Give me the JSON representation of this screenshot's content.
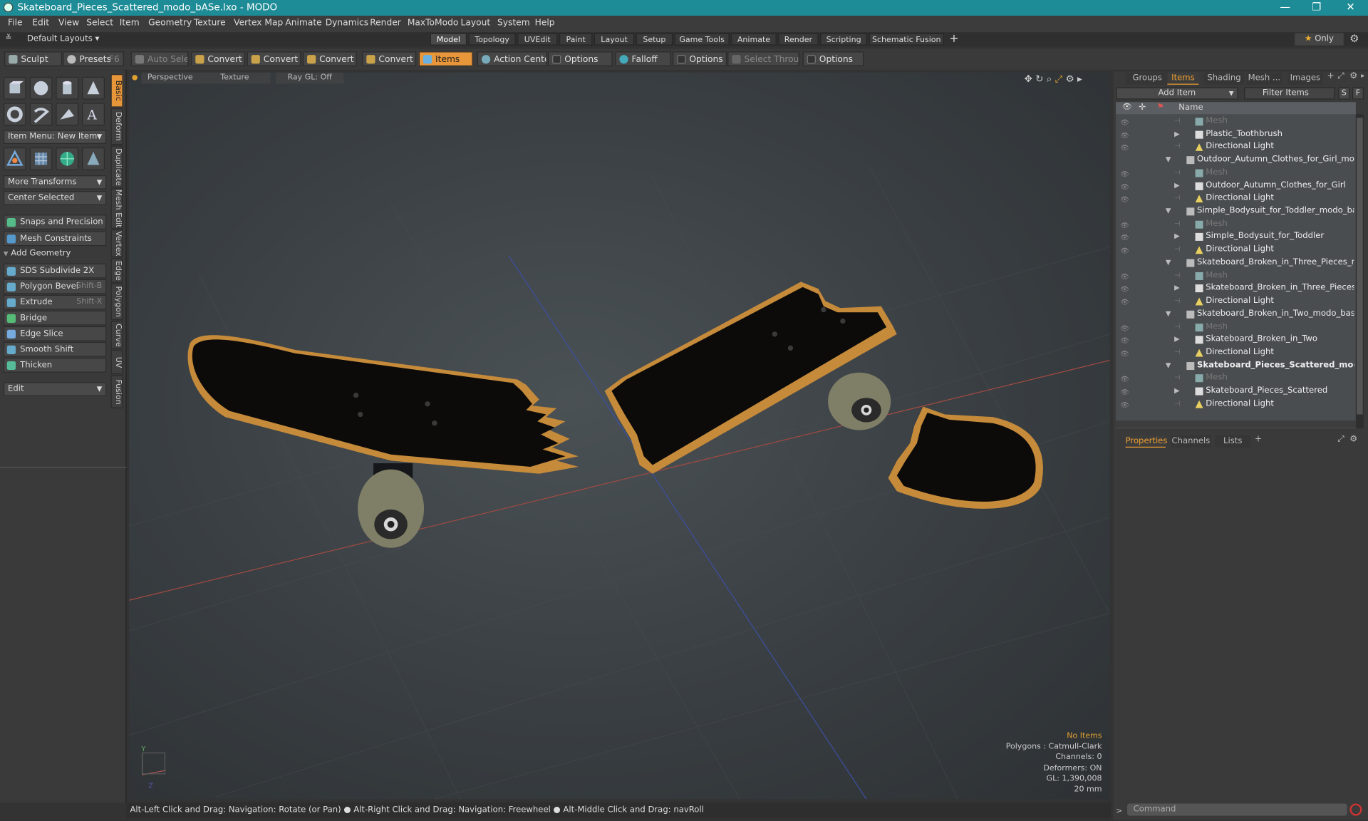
{
  "title": "Skateboard_Pieces_Scattered_modo_bASe.lxo - MODO",
  "window_controls": [
    "—",
    "❐",
    "✕"
  ],
  "menu": [
    "File",
    "Edit",
    "View",
    "Select",
    "Item",
    "Geometry",
    "Texture",
    "Vertex Map",
    "Animate",
    "Dynamics",
    "Render",
    "MaxToModo",
    "Layout",
    "System",
    "Help"
  ],
  "layout_selector": "Default Layouts",
  "layout_tabs": [
    "Model",
    "Topology",
    "UVEdit",
    "Paint",
    "Layout",
    "Setup",
    "Game Tools",
    "Animate",
    "Render",
    "Scripting",
    "Schematic Fusion"
  ],
  "active_layout_tab": "Model",
  "only_label": "Only",
  "toolbar": {
    "sculpt": "Sculpt",
    "presets": "Presets",
    "presets_key": "F6",
    "auto_select": "Auto Select",
    "convert1": "Convert",
    "convert2": "Convert",
    "convert3": "Convert",
    "convert4": "Convert",
    "items": "Items",
    "action_center": "Action Center",
    "options1": "Options",
    "falloff": "Falloff",
    "options2": "Options",
    "select_through": "Select Through",
    "options3": "Options"
  },
  "left_panel": {
    "item_menu": "Item Menu: New Item",
    "more_transforms": "More Transforms",
    "center_selected": "Center Selected",
    "snaps": "Snaps and Precision",
    "mesh_constraints": "Mesh Constraints",
    "add_geometry": "Add Geometry",
    "tools": [
      {
        "label": "SDS Subdivide 2X",
        "shortcut": ""
      },
      {
        "label": "Polygon Bevel",
        "shortcut": "Shift-B"
      },
      {
        "label": "Extrude",
        "shortcut": "Shift-X"
      },
      {
        "label": "Bridge",
        "shortcut": ""
      },
      {
        "label": "Edge Slice",
        "shortcut": ""
      },
      {
        "label": "Smooth Shift",
        "shortcut": ""
      },
      {
        "label": "Thicken",
        "shortcut": ""
      }
    ],
    "edit": "Edit",
    "vertical_tabs": [
      "Basic",
      "Deform",
      "Duplicate",
      "Mesh Edit",
      "Vertex",
      "Edge",
      "Polygon",
      "Curve",
      "UV",
      "Fusion"
    ]
  },
  "viewport": {
    "header": [
      "Perspective",
      "Texture",
      "Ray GL: Off"
    ],
    "info": {
      "no_items": "No Items",
      "polygons": "Polygons : Catmull-Clark",
      "channels": "Channels: 0",
      "deformers": "Deformers: ON",
      "gl": "GL: 1,390,008",
      "scale": "20 mm"
    }
  },
  "status": "Alt-Left Click and Drag: Navigation: Rotate (or Pan) ● Alt-Right Click and Drag: Navigation: Freewheel ● Alt-Middle Click and Drag: navRoll",
  "right_panel": {
    "tabs": [
      "Groups",
      "Items",
      "Shading",
      "Mesh ...",
      "Images"
    ],
    "active_tab": "Items",
    "add_item": "Add Item",
    "filter_items": "Filter Items",
    "s_btn": "S",
    "f_btn": "F",
    "name_header": "Name",
    "tree": [
      {
        "label": "Mesh",
        "level": 2,
        "type": "mesh",
        "dim": true
      },
      {
        "label": "Plastic_Toothbrush",
        "level": 2,
        "type": "group",
        "exp": "▶"
      },
      {
        "label": "Directional Light",
        "level": 2,
        "type": "light"
      },
      {
        "label": "Outdoor_Autumn_Clothes_for_Girl_modo_...",
        "level": 1,
        "type": "scene",
        "exp": "▼"
      },
      {
        "label": "Mesh",
        "level": 2,
        "type": "mesh",
        "dim": true
      },
      {
        "label": "Outdoor_Autumn_Clothes_for_Girl",
        "level": 2,
        "type": "group",
        "exp": "▶"
      },
      {
        "label": "Directional Light",
        "level": 2,
        "type": "light"
      },
      {
        "label": "Simple_Bodysuit_for_Toddler_modo_base.lxo",
        "level": 1,
        "type": "scene",
        "exp": "▼"
      },
      {
        "label": "Mesh",
        "level": 2,
        "type": "mesh",
        "dim": true
      },
      {
        "label": "Simple_Bodysuit_for_Toddler",
        "level": 2,
        "type": "group",
        "exp": "▶"
      },
      {
        "label": "Directional Light",
        "level": 2,
        "type": "light"
      },
      {
        "label": "Skateboard_Broken_in_Three_Pieces_mod ...",
        "level": 1,
        "type": "scene",
        "exp": "▼"
      },
      {
        "label": "Mesh",
        "level": 2,
        "type": "mesh",
        "dim": true
      },
      {
        "label": "Skateboard_Broken_in_Three_Pieces",
        "level": 2,
        "type": "group",
        "exp": "▶"
      },
      {
        "label": "Directional Light",
        "level": 2,
        "type": "light"
      },
      {
        "label": "Skateboard_Broken_in_Two_modo_base.lxo",
        "level": 1,
        "type": "scene",
        "exp": "▼"
      },
      {
        "label": "Mesh",
        "level": 2,
        "type": "mesh",
        "dim": true
      },
      {
        "label": "Skateboard_Broken_in_Two",
        "level": 2,
        "type": "group",
        "exp": "▶"
      },
      {
        "label": "Directional Light",
        "level": 2,
        "type": "light"
      },
      {
        "label": "Skateboard_Pieces_Scattered_mod ...",
        "level": 1,
        "type": "scene",
        "exp": "▼",
        "bold": true
      },
      {
        "label": "Mesh",
        "level": 2,
        "type": "mesh",
        "dim": true
      },
      {
        "label": "Skateboard_Pieces_Scattered",
        "level": 2,
        "type": "group",
        "exp": "▶"
      },
      {
        "label": "Directional Light",
        "level": 2,
        "type": "light"
      }
    ],
    "bottom_tabs": [
      "Properties",
      "Channels",
      "Lists"
    ],
    "active_bottom_tab": "Properties",
    "command_placeholder": "Command"
  },
  "colors": {
    "titlebar": "#1e8c96",
    "accent": "#e8963a",
    "active_tab_text": "#f0a030"
  }
}
